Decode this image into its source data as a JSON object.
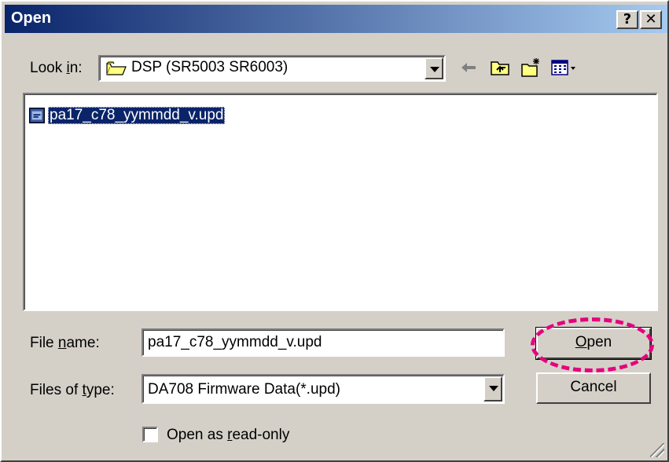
{
  "window": {
    "title": "Open",
    "help_button": "?",
    "close_button": "✕"
  },
  "look_in": {
    "label_pre": "Look ",
    "label_key": "i",
    "label_post": "n:",
    "value": "DSP (SR5003 SR6003)",
    "folder_icon": "open-folder-icon"
  },
  "toolbar": {
    "icons": [
      "back-arrow-icon",
      "up-one-level-icon",
      "create-new-folder-icon",
      "view-menu-icon"
    ]
  },
  "file_list": {
    "items": [
      {
        "name": "pa17_c78_yymmdd_v.upd",
        "icon": "upd-file-icon",
        "selected": true
      }
    ]
  },
  "file_name": {
    "label_pre": "File ",
    "label_key": "n",
    "label_post": "ame:",
    "value": "pa17_c78_yymmdd_v.upd"
  },
  "files_of_type": {
    "label_pre": "Files of ",
    "label_key": "t",
    "label_post": "ype:",
    "value": "DA708 Firmware Data(*.upd)"
  },
  "buttons": {
    "open_key": "O",
    "open_rest": "pen",
    "cancel": "Cancel"
  },
  "readonly": {
    "label_pre": "Open as ",
    "label_key": "r",
    "label_post": "ead-only",
    "checked": false
  },
  "colors": {
    "title_bar": "#0a246a",
    "selection": "#0a246a",
    "highlight_ring": "#e6007e",
    "dialog_face": "#d4d0c8"
  }
}
